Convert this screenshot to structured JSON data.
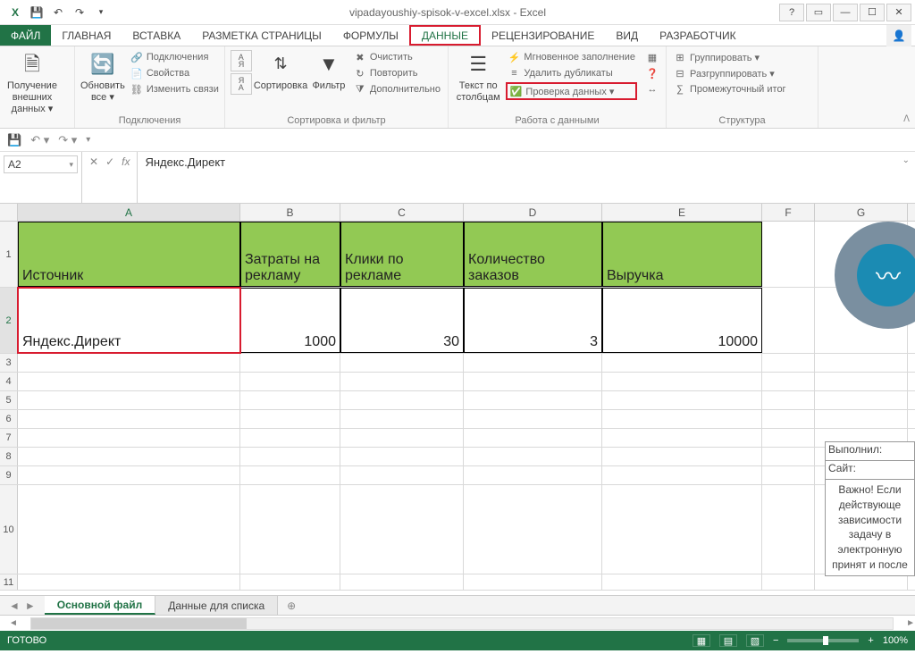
{
  "window": {
    "title": "vipadayoushiy-spisok-v-excel.xlsx - Excel"
  },
  "tabs": {
    "file": "ФАЙЛ",
    "items": [
      "ГЛАВНАЯ",
      "ВСТАВКА",
      "РАЗМЕТКА СТРАНИЦЫ",
      "ФОРМУЛЫ",
      "ДАННЫЕ",
      "РЕЦЕНЗИРОВАНИЕ",
      "ВИД",
      "РАЗРАБОТЧИК"
    ],
    "active_index": 4
  },
  "ribbon": {
    "group1": {
      "big": "Получение\nвнешних данных ▾"
    },
    "group2": {
      "big": "Обновить\nвсе ▾",
      "items": [
        "Подключения",
        "Свойства",
        "Изменить связи"
      ],
      "label": "Подключения"
    },
    "group3": {
      "az": "А\nЯ",
      "za": "Я\nА",
      "sort": "Сортировка",
      "filter": "Фильтр",
      "items": [
        "Очистить",
        "Повторить",
        "Дополнительно"
      ],
      "label": "Сортировка и фильтр"
    },
    "group4": {
      "big": "Текст по\nстолбцам",
      "items": [
        "Мгновенное заполнение",
        "Удалить дубликаты",
        "Проверка данных  ▾"
      ],
      "label": "Работа с данными"
    },
    "group5": {
      "items": [
        "Группировать  ▾",
        "Разгруппировать  ▾",
        "Промежуточный итог"
      ],
      "label": "Структура"
    }
  },
  "namebox": "A2",
  "formula": "Яндекс.Директ",
  "columns": [
    "A",
    "B",
    "C",
    "D",
    "E",
    "F",
    "G"
  ],
  "headers": {
    "A": "Источник",
    "B": "Затраты на рекламу",
    "C": "Клики по рекламе",
    "D": "Количество заказов",
    "E": "Выручка"
  },
  "row2": {
    "A": "Яндекс.Директ",
    "B": "1000",
    "C": "30",
    "D": "3",
    "E": "10000"
  },
  "row_numbers": [
    "1",
    "2",
    "3",
    "4",
    "5",
    "6",
    "7",
    "8",
    "9",
    "10",
    "11"
  ],
  "side": {
    "r1": "Выполнил:",
    "r2": "Сайт:",
    "r3": "Важно! Если действующе зависимости задачу в электронную принят и после"
  },
  "sheets": {
    "active": "Основной файл",
    "other": "Данные для списка"
  },
  "status": {
    "ready": "ГОТОВО",
    "zoom": "100%"
  }
}
